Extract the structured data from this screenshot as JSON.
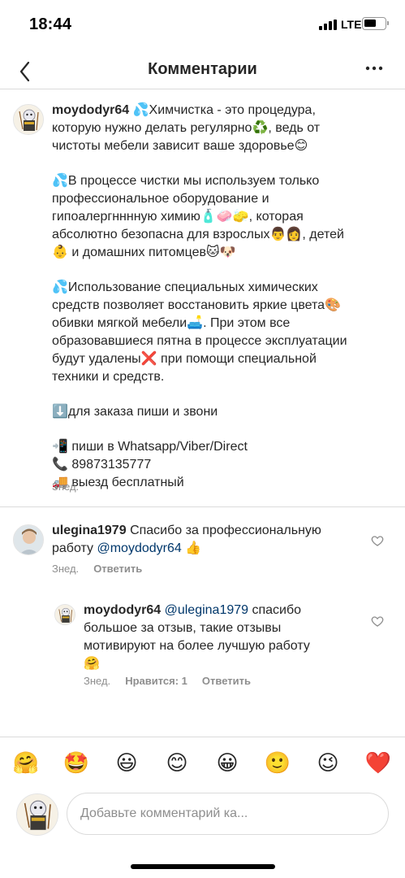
{
  "status": {
    "time": "18:44",
    "network": "LTE"
  },
  "nav": {
    "title": "Комментарии"
  },
  "post": {
    "username": "moydodyr64",
    "lines": [
      "💦Химчистка - это процедура,",
      "которую нужно делать регулярно♻️, ведь от",
      "чистоты мебели зависит ваше здоровье😊",
      "",
      "💦В процессе чистки мы используем только",
      "профессиональное оборудование и",
      "гипоалергнннную химию🧴🧼🧽, которая",
      "абсолютно безопасна для взрослых👨👩, детей",
      "👶 и домашних питомцев🐱🐶",
      "",
      "💦Использование специальных химических",
      "средств позволяет восстановить яркие цвета🎨",
      "обивки мягкой мебели🛋️. При этом все",
      "образовавшиеся пятна в процессе эксплуатации",
      "будут удалены❌ при помощи специальной",
      "техники и средств.",
      "",
      "⬇️для заказа пиши и звони",
      "",
      "📲 пиши в Whatsapp/Viber/Direct",
      "📞 89873135777",
      "🚚 выезд бесплатный"
    ],
    "time": "Знед."
  },
  "comment1": {
    "username": "ulegina1979",
    "line1": "Спасибо за профессиональную",
    "line2_prefix": "работу ",
    "mention": "@moydodyr64",
    "line2_suffix": " 👍",
    "time": "Знед.",
    "reply_label": "Ответить"
  },
  "reply1": {
    "username": "moydodyr64",
    "mention": "@ulegina1979",
    "line1_suffix": " спасибо",
    "line2": "большое за отзыв, такие отзывы",
    "line3": "мотивируют на более лучшую работу",
    "line4": "🤗",
    "time": "Знед.",
    "likes_label": "Нравится: 1",
    "reply_label": "Ответить"
  },
  "emoji_bar": [
    "🤗",
    "🤩",
    "😃",
    "😊",
    "😀",
    "🙂",
    "😉",
    "❤️"
  ],
  "composer": {
    "placeholder": "Добавьте комментарий ка..."
  }
}
